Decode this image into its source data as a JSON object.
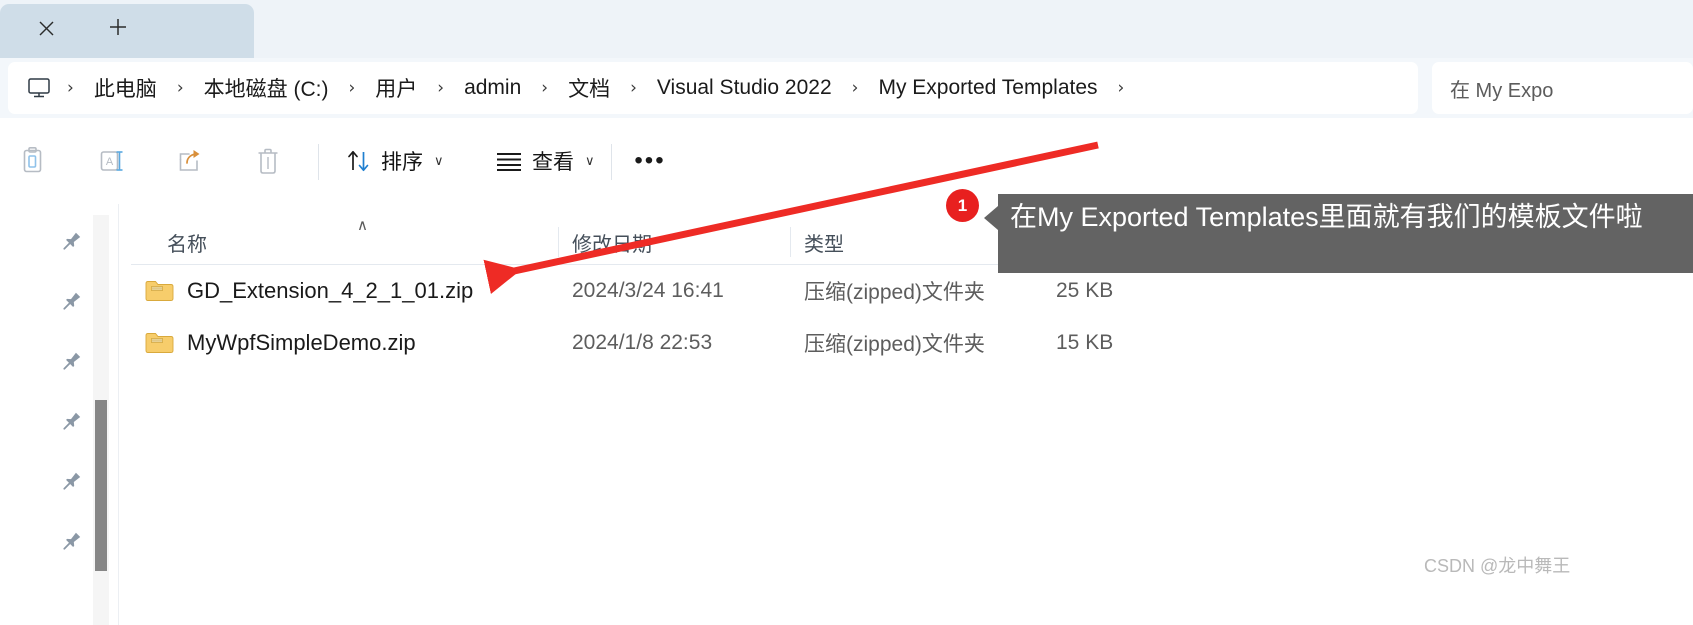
{
  "window": {
    "tab": {
      "close_label": "×",
      "new_tab_label": "+"
    }
  },
  "breadcrumb": {
    "home_icon": "this-pc-monitor-icon",
    "separator": "›",
    "items": [
      "此电脑",
      "本地磁盘 (C:)",
      "用户",
      "admin",
      "文档",
      "Visual Studio 2022",
      "My Exported Templates"
    ]
  },
  "search": {
    "text": "在 My Expo"
  },
  "toolbar": {
    "icons": [
      {
        "name": "paste-icon",
        "title": "粘贴",
        "disabled": true
      },
      {
        "name": "rename-icon",
        "title": "重命名",
        "disabled": true
      },
      {
        "name": "share-icon",
        "title": "共享",
        "disabled": true
      },
      {
        "name": "delete-icon",
        "title": "删除",
        "disabled": true
      }
    ],
    "sort_label": "排序",
    "view_label": "查看",
    "chevron": "∨",
    "more_label": "•••"
  },
  "columns": {
    "name": "名称",
    "date": "修改日期",
    "type": "类型",
    "sort_caret": "∧"
  },
  "files": [
    {
      "name": "GD_Extension_4_2_1_01.zip",
      "date": "2024/3/24 16:41",
      "type": "压缩(zipped)文件夹",
      "size": "25 KB"
    },
    {
      "name": "MyWpfSimpleDemo.zip",
      "date": "2024/1/8 22:53",
      "type": "压缩(zipped)文件夹",
      "size": "15 KB"
    }
  ],
  "annotation": {
    "badge": "1",
    "text": "在My Exported Templates里面就有我们的模板文件啦",
    "arrow_color": "#ee2b25"
  },
  "watermark": "CSDN @龙中舞王",
  "colors": {
    "tab_active": "#cfdde8",
    "tabstrip": "#eef3f8",
    "addressbar": "#f3f7fb",
    "callout_bg": "#636363",
    "badge_bg": "#e8201f",
    "accent_blue": "#2c8fd6"
  }
}
